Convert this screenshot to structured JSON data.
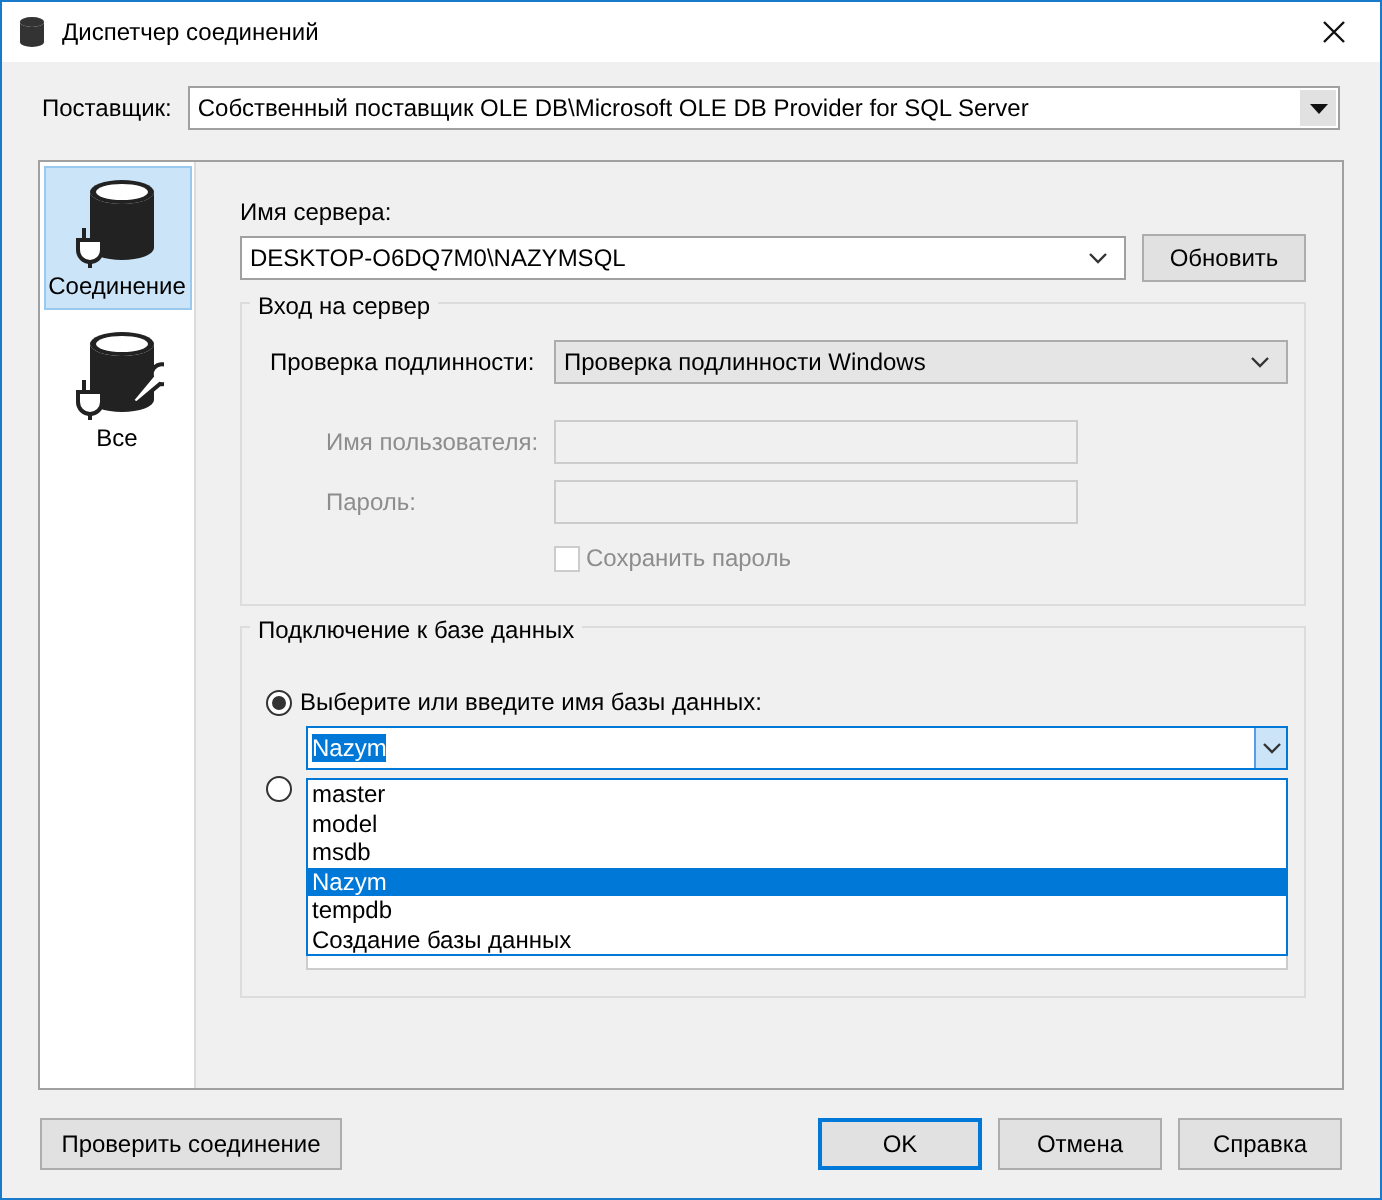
{
  "window": {
    "title": "Диспетчер соединений"
  },
  "provider": {
    "label": "Поставщик:",
    "value": "Собственный поставщик OLE DB\\Microsoft OLE DB Provider for SQL Server"
  },
  "sidebar": {
    "items": [
      {
        "label": "Соединение",
        "selected": true,
        "kind": "connection"
      },
      {
        "label": "Все",
        "selected": false,
        "kind": "all"
      }
    ]
  },
  "server": {
    "label": "Имя сервера:",
    "value": "DESKTOP-O6DQ7M0\\NAZYMSQL",
    "refresh_button": "Обновить"
  },
  "login": {
    "title": "Вход на сервер",
    "auth_label": "Проверка подлинности:",
    "auth_value": "Проверка подлинности Windows",
    "credentials_disabled": true,
    "username_label": "Имя пользователя:",
    "password_label": "Пароль:",
    "save_password": {
      "label": "Сохранить пароль",
      "checked": false
    }
  },
  "database": {
    "title": "Подключение к базе данных",
    "options": [
      {
        "label": "Выберите или введите имя базы данных:",
        "selected": true
      },
      {
        "selected": false
      }
    ],
    "value": "Nazym",
    "list_open": true,
    "list": [
      {
        "label": "master",
        "selected": false
      },
      {
        "label": "model",
        "selected": false
      },
      {
        "label": "msdb",
        "selected": false
      },
      {
        "label": "Nazym",
        "selected": true
      },
      {
        "label": "tempdb",
        "selected": false
      },
      {
        "label": "Создание базы данных",
        "selected": false
      }
    ]
  },
  "buttons": {
    "test": "Проверить соединение",
    "ok": "OK",
    "cancel": "Отмена",
    "help": "Справка"
  }
}
